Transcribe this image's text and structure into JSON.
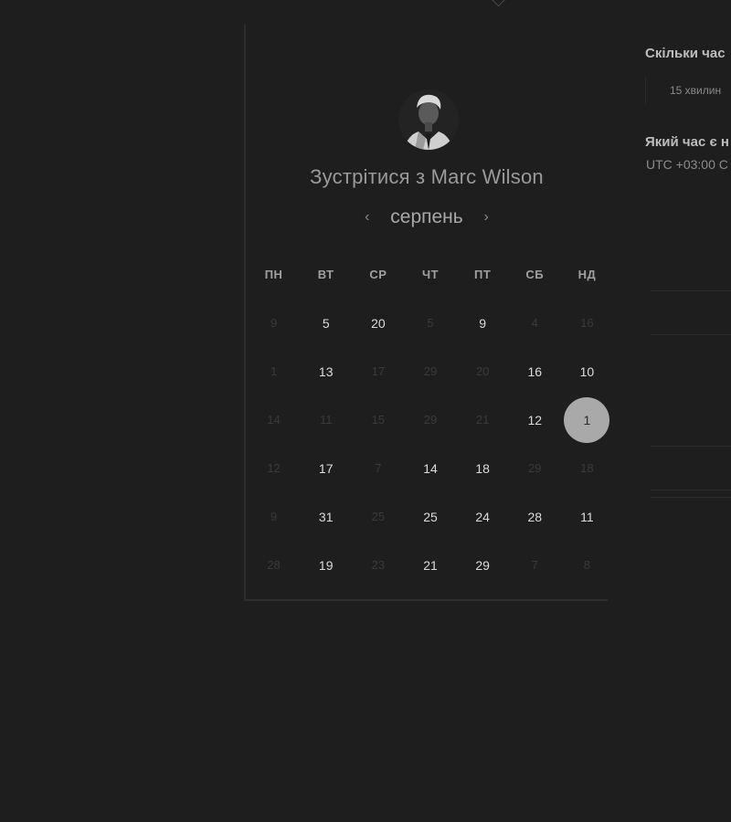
{
  "host": {
    "title": "Зустрітися з Marc Wilson"
  },
  "calendar": {
    "month": "серпень",
    "prev": "‹",
    "next": "›",
    "weekdays": [
      "ПН",
      "ВТ",
      "СР",
      "ЧТ",
      "ПТ",
      "СБ",
      "НД"
    ],
    "weeks": [
      [
        {
          "d": "9",
          "a": false
        },
        {
          "d": "5",
          "a": true
        },
        {
          "d": "20",
          "a": true
        },
        {
          "d": "5",
          "a": false
        },
        {
          "d": "9",
          "a": true
        },
        {
          "d": "4",
          "a": false
        },
        {
          "d": "16",
          "a": false
        }
      ],
      [
        {
          "d": "1",
          "a": false
        },
        {
          "d": "13",
          "a": true
        },
        {
          "d": "17",
          "a": false
        },
        {
          "d": "29",
          "a": false
        },
        {
          "d": "20",
          "a": false
        },
        {
          "d": "16",
          "a": true
        },
        {
          "d": "10",
          "a": true
        }
      ],
      [
        {
          "d": "14",
          "a": false
        },
        {
          "d": "11",
          "a": false
        },
        {
          "d": "15",
          "a": false
        },
        {
          "d": "29",
          "a": false
        },
        {
          "d": "21",
          "a": false
        },
        {
          "d": "12",
          "a": true
        },
        {
          "d": "1",
          "a": true,
          "selected": true
        }
      ],
      [
        {
          "d": "12",
          "a": false
        },
        {
          "d": "17",
          "a": true
        },
        {
          "d": "7",
          "a": false
        },
        {
          "d": "14",
          "a": true
        },
        {
          "d": "18",
          "a": true
        },
        {
          "d": "29",
          "a": false
        },
        {
          "d": "18",
          "a": false
        }
      ],
      [
        {
          "d": "9",
          "a": false
        },
        {
          "d": "31",
          "a": true
        },
        {
          "d": "25",
          "a": false
        },
        {
          "d": "25",
          "a": true
        },
        {
          "d": "24",
          "a": true
        },
        {
          "d": "28",
          "a": true
        },
        {
          "d": "11",
          "a": true
        }
      ],
      [
        {
          "d": "28",
          "a": false
        },
        {
          "d": "19",
          "a": true
        },
        {
          "d": "23",
          "a": false
        },
        {
          "d": "21",
          "a": true
        },
        {
          "d": "29",
          "a": true
        },
        {
          "d": "7",
          "a": false
        },
        {
          "d": "8",
          "a": false
        }
      ]
    ]
  },
  "duration": {
    "question": "Скільки час",
    "option": "15 хвилин"
  },
  "timezone": {
    "question": "Який час є н",
    "value": "UTC +03:00 C"
  }
}
